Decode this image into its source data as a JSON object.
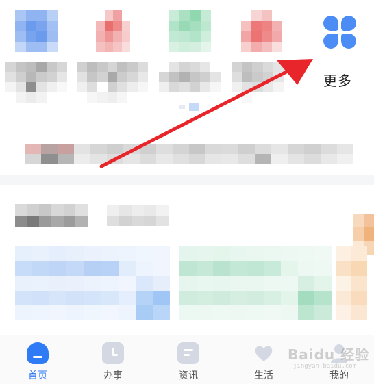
{
  "top_grid": {
    "more_label": "更多"
  },
  "tabbar": {
    "tabs": [
      {
        "label": "首页",
        "icon": "home-icon",
        "active": true
      },
      {
        "label": "办事",
        "icon": "clock-icon",
        "active": false
      },
      {
        "label": "资讯",
        "icon": "news-icon",
        "active": false
      },
      {
        "label": "生活",
        "icon": "heart-icon",
        "active": false
      },
      {
        "label": "我的",
        "icon": "user-icon",
        "active": false
      }
    ]
  },
  "watermark": {
    "text": "Baidu 经验",
    "sub": "jingyan.baidu.com"
  },
  "colors": {
    "accent": "#2f7bf6",
    "arrow": "#e8252a",
    "more_icon": "#4b8cf5"
  }
}
